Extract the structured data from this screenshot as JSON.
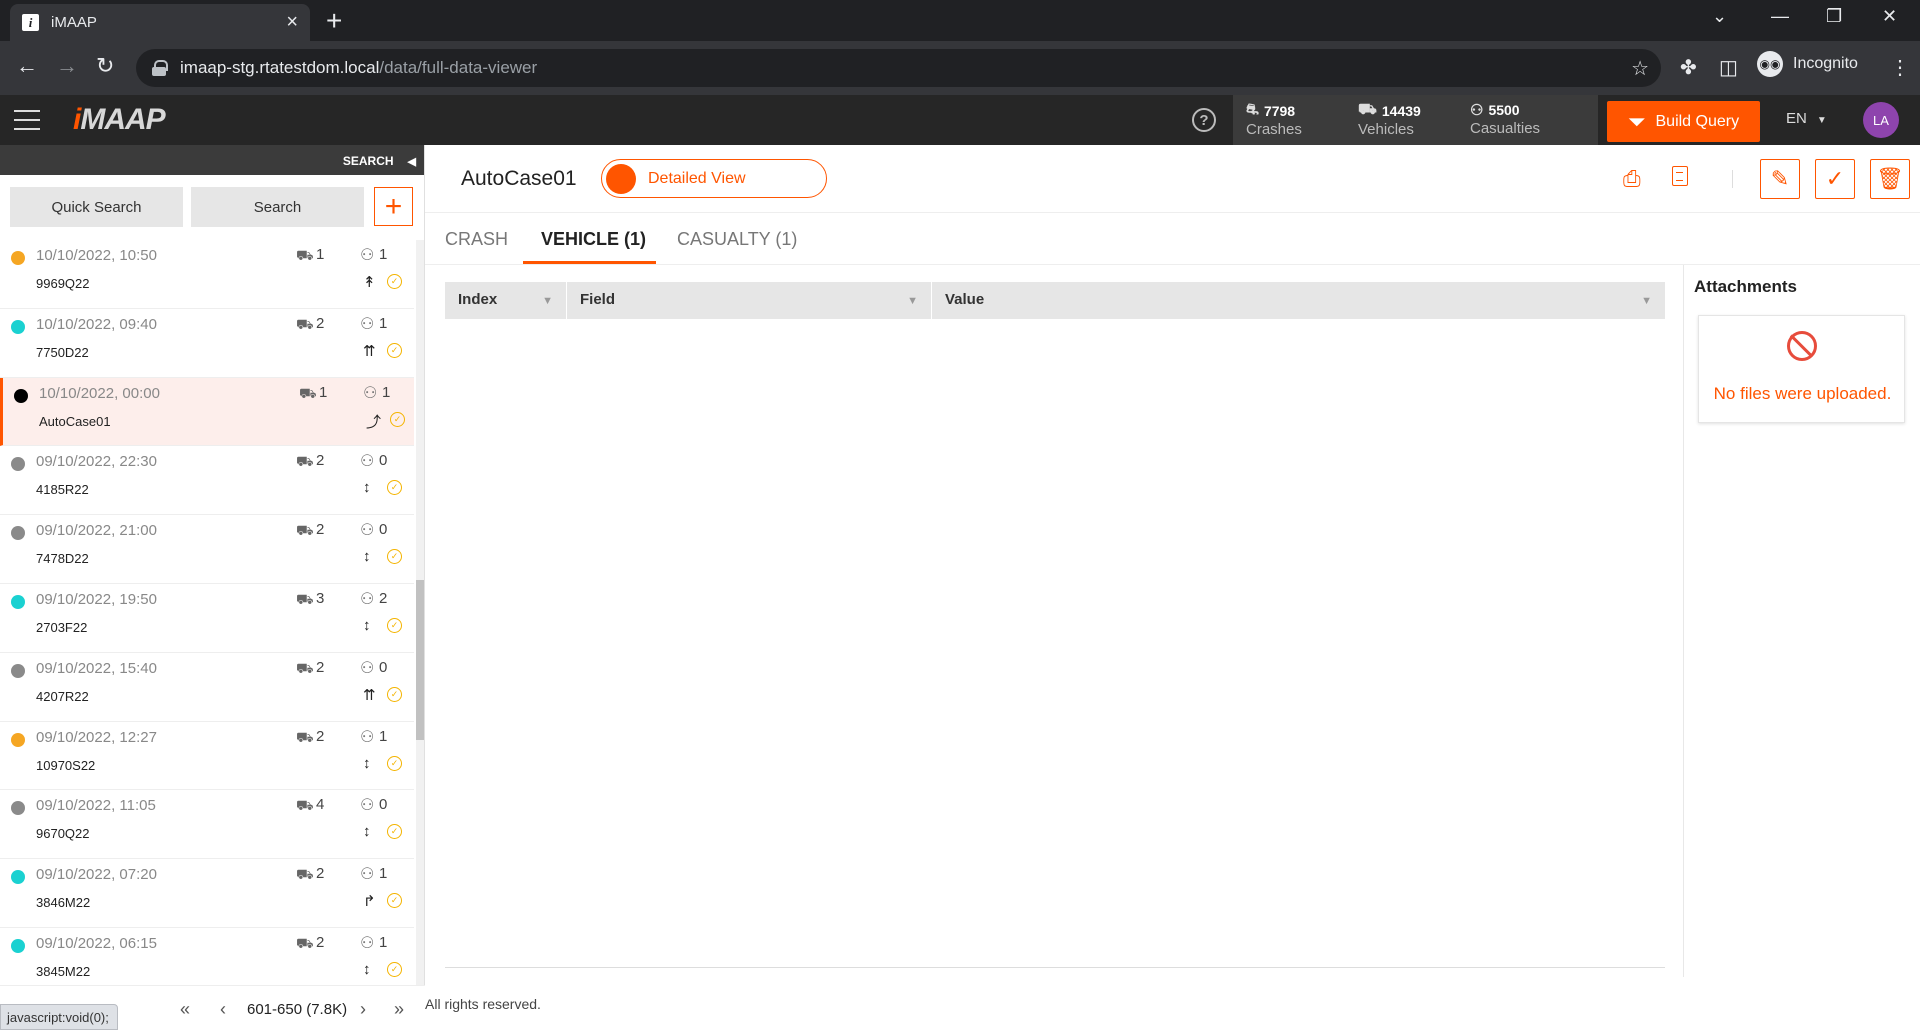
{
  "browser": {
    "tab_title": "iMAAP",
    "url_host": "imaap-stg.rtatestdom.local",
    "url_path": "/data/full-data-viewer",
    "profile_label": "Incognito",
    "status_tip": "javascript:void(0);"
  },
  "header": {
    "logo_i": "i",
    "logo_rest": "MAAP",
    "stats": [
      {
        "icon": "crash-icon",
        "value": "7798",
        "label": "Crashes"
      },
      {
        "icon": "vehicle-icon",
        "value": "14439",
        "label": "Vehicles"
      },
      {
        "icon": "person-icon",
        "value": "5500",
        "label": "Casualties"
      }
    ],
    "build_query_label": "Build Query",
    "language": "EN",
    "avatar_initials": "LA"
  },
  "sidebar": {
    "search_label": "SEARCH",
    "quick_search_label": "Quick Search",
    "search_button_label": "Search",
    "cases": [
      {
        "time": "10/10/2022, 10:50",
        "id": "9969Q22",
        "vehicles": "1",
        "casualties": "1",
        "color": "#f5a623",
        "arrow": "↟",
        "selected": false
      },
      {
        "time": "10/10/2022, 09:40",
        "id": "7750D22",
        "vehicles": "2",
        "casualties": "1",
        "color": "#1ad1d1",
        "arrow": "⇈",
        "selected": false
      },
      {
        "time": "10/10/2022, 00:00",
        "id": "AutoCase01",
        "vehicles": "1",
        "casualties": "1",
        "color": "#000000",
        "arrow": "⤴",
        "selected": true
      },
      {
        "time": "09/10/2022, 22:30",
        "id": "4185R22",
        "vehicles": "2",
        "casualties": "0",
        "color": "#8a8a8a",
        "arrow": "↕",
        "selected": false
      },
      {
        "time": "09/10/2022, 21:00",
        "id": "7478D22",
        "vehicles": "2",
        "casualties": "0",
        "color": "#8a8a8a",
        "arrow": "↕",
        "selected": false
      },
      {
        "time": "09/10/2022, 19:50",
        "id": "2703F22",
        "vehicles": "3",
        "casualties": "2",
        "color": "#1ad1d1",
        "arrow": "↕",
        "selected": false
      },
      {
        "time": "09/10/2022, 15:40",
        "id": "4207R22",
        "vehicles": "2",
        "casualties": "0",
        "color": "#8a8a8a",
        "arrow": "⇈",
        "selected": false
      },
      {
        "time": "09/10/2022, 12:27",
        "id": "10970S22",
        "vehicles": "2",
        "casualties": "1",
        "color": "#f5a623",
        "arrow": "↕",
        "selected": false
      },
      {
        "time": "09/10/2022, 11:05",
        "id": "9670Q22",
        "vehicles": "4",
        "casualties": "0",
        "color": "#8a8a8a",
        "arrow": "↕",
        "selected": false
      },
      {
        "time": "09/10/2022, 07:20",
        "id": "3846M22",
        "vehicles": "2",
        "casualties": "1",
        "color": "#1ad1d1",
        "arrow": "↱",
        "selected": false
      },
      {
        "time": "09/10/2022, 06:15",
        "id": "3845M22",
        "vehicles": "2",
        "casualties": "1",
        "color": "#1ad1d1",
        "arrow": "↕",
        "selected": false
      }
    ],
    "pager_label": "601-650 (7.8K)"
  },
  "main": {
    "case_title": "AutoCase01",
    "view_toggle_label": "Detailed View",
    "tabs": [
      {
        "label": "CRASH",
        "active": false
      },
      {
        "label": "VEHICLE (1)",
        "active": true
      },
      {
        "label": "CASUALTY (1)",
        "active": false
      }
    ],
    "grid_columns": [
      "Index",
      "Field",
      "Value"
    ],
    "footer": "All rights reserved.",
    "attachments_title": "Attachments",
    "no_files_text": "No files were uploaded."
  },
  "colors": {
    "accent": "#ff5500",
    "header_bg": "#262626",
    "avatar": "#8e44ad"
  }
}
